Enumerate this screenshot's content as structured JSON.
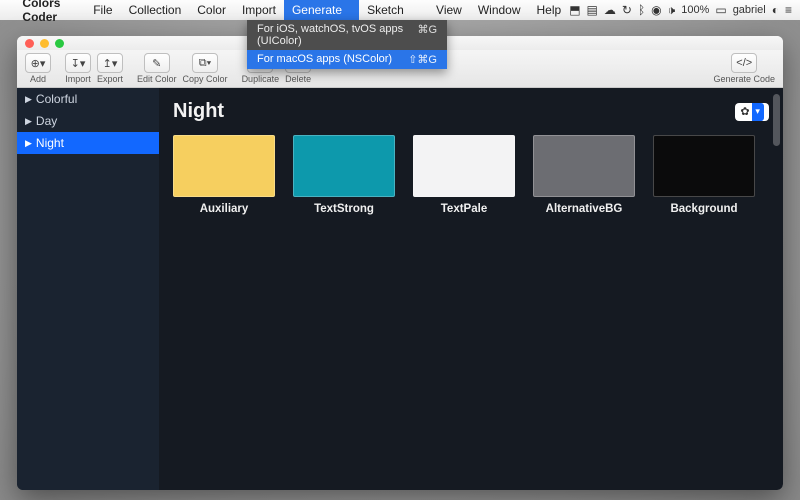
{
  "menubar": {
    "app_name": "Colors Coder",
    "items": [
      "File",
      "Collection",
      "Color",
      "Import",
      "Generate Code",
      "Sketch Plugin",
      "View",
      "Window",
      "Help"
    ],
    "open_index": 4,
    "status": {
      "battery": "100%",
      "user": "gabriel"
    }
  },
  "dropdown": {
    "rows": [
      {
        "label": "For iOS, watchOS, tvOS apps (UIColor)",
        "shortcut": "⌘G",
        "selected": false
      },
      {
        "label": "For macOS apps (NSColor)",
        "shortcut": "⇧⌘G",
        "selected": true
      }
    ]
  },
  "toolbar": {
    "add": "Add",
    "import": "Import",
    "export": "Export",
    "edit": "Edit Color",
    "copy": "Copy Color",
    "dup": "Duplicate",
    "del": "Delete",
    "gen": "Generate Code"
  },
  "sidebar": {
    "items": [
      {
        "label": "Colorful",
        "active": false
      },
      {
        "label": "Day",
        "active": false
      },
      {
        "label": "Night",
        "active": true
      }
    ]
  },
  "main": {
    "title": "Night",
    "swatches": [
      {
        "name": "Auxiliary",
        "color": "#f6cf5f"
      },
      {
        "name": "TextStrong",
        "color": "#0d99ac"
      },
      {
        "name": "TextPale",
        "color": "#f3f3f4"
      },
      {
        "name": "AlternativeBG",
        "color": "#6c6d72"
      },
      {
        "name": "Background",
        "color": "#0b0b0c"
      }
    ]
  }
}
